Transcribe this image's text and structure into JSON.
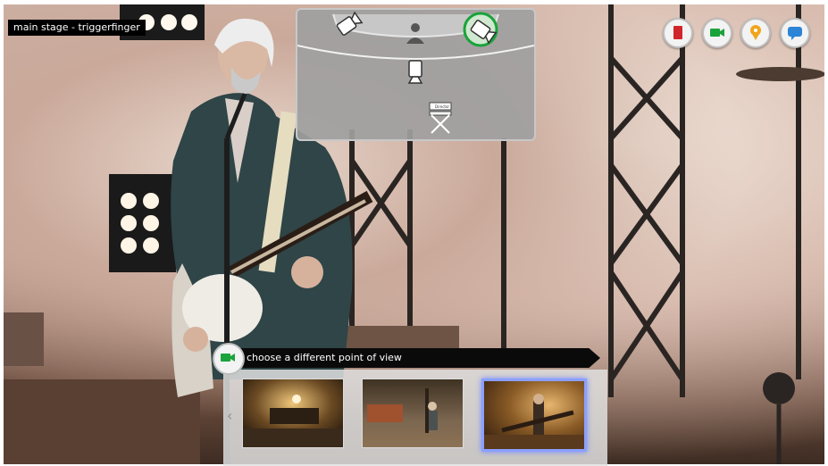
{
  "overlay": {
    "stage_label": "main stage - triggerfinger"
  },
  "camera_map": {
    "cameras": [
      {
        "name": "camera-left-icon",
        "selected": false
      },
      {
        "name": "camera-right-icon",
        "selected": true
      },
      {
        "name": "camera-center-icon",
        "selected": false
      }
    ],
    "icons": [
      "performer-icon",
      "director-chair-icon"
    ],
    "chair_text": "Director"
  },
  "top_buttons": [
    {
      "name": "bookmark-button",
      "icon": "bookmark-icon",
      "color": "#d0262b"
    },
    {
      "name": "camera-view-button",
      "icon": "video-camera-icon",
      "color": "#1aa33a"
    },
    {
      "name": "location-button",
      "icon": "map-pin-icon",
      "color": "#f0a51c"
    },
    {
      "name": "chat-button",
      "icon": "speech-bubble-icon",
      "color": "#2b84d6"
    }
  ],
  "pov": {
    "title": "choose a different point of view",
    "icon": "video-camera-icon",
    "thumbnails": [
      {
        "name": "pov-thumbnail-1",
        "selected": false
      },
      {
        "name": "pov-thumbnail-2",
        "selected": false
      },
      {
        "name": "pov-thumbnail-3",
        "selected": true
      }
    ],
    "prev_arrow": "‹"
  },
  "colors": {
    "accent_green": "#1aa33a",
    "selection_blue": "#7f95ff"
  }
}
